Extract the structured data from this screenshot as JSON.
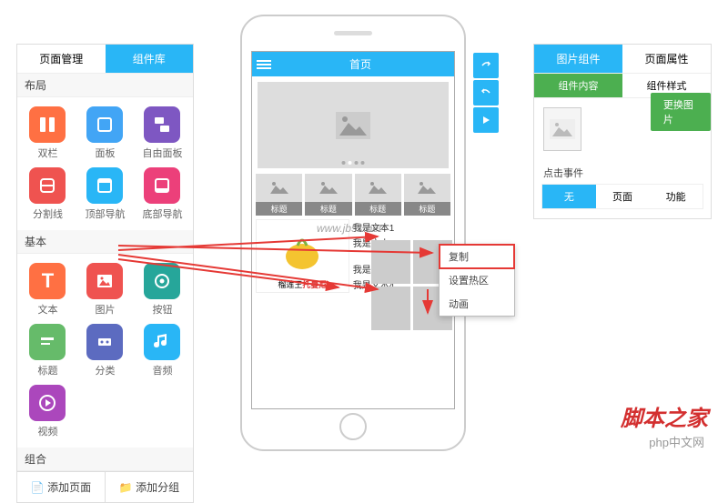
{
  "left": {
    "tabs": [
      "页面管理",
      "组件库"
    ],
    "sections": {
      "layout": {
        "title": "布局",
        "items": [
          {
            "label": "双栏",
            "color": "#ff7043"
          },
          {
            "label": "面板",
            "color": "#42a5f5"
          },
          {
            "label": "自由面板",
            "color": "#7e57c2"
          },
          {
            "label": "分割线",
            "color": "#ef5350"
          },
          {
            "label": "顶部导航",
            "color": "#29b6f6"
          },
          {
            "label": "底部导航",
            "color": "#ec407a"
          }
        ]
      },
      "basic": {
        "title": "基本",
        "items": [
          {
            "label": "文本",
            "color": "#ff7043"
          },
          {
            "label": "图片",
            "color": "#ef5350"
          },
          {
            "label": "按钮",
            "color": "#26a69a"
          },
          {
            "label": "标题",
            "color": "#66bb6a"
          },
          {
            "label": "分类",
            "color": "#5c6bc0"
          },
          {
            "label": "音频",
            "color": "#29b6f6"
          },
          {
            "label": "视频",
            "color": "#ab47bc"
          }
        ]
      },
      "combo": {
        "title": "组合"
      }
    },
    "buttons": {
      "add_page": "添加页面",
      "add_group": "添加分组"
    }
  },
  "phone": {
    "title": "首页",
    "thumb_captions": [
      "标题",
      "标题",
      "标题",
      "标题"
    ],
    "texts": [
      "我是文本1",
      "我是文本2",
      "我是文本3",
      "我是文本4"
    ],
    "product": {
      "prefix": "榴莲王",
      "highlight": "托曼尼"
    },
    "watermark": "www.jb51.net"
  },
  "context_menu": [
    "复制",
    "设置热区",
    "动画"
  ],
  "right": {
    "tabs": [
      "图片组件",
      "页面属性"
    ],
    "subtabs": [
      "组件内容",
      "组件样式"
    ],
    "change_btn": "更换图片",
    "event_label": "点击事件",
    "event_tabs": [
      "无",
      "页面",
      "功能"
    ]
  },
  "branding": {
    "site1": "脚本之家",
    "site2": "php中文网"
  }
}
